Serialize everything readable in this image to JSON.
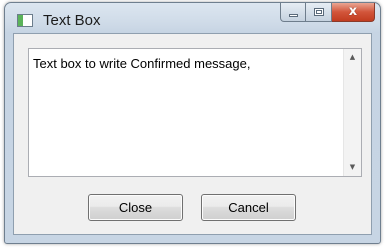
{
  "window": {
    "title": "Text Box",
    "close_glyph": "x"
  },
  "textbox": {
    "value": "Text box to write Confirmed message,",
    "scroll_up_glyph": "▲",
    "scroll_down_glyph": "▼"
  },
  "buttons": {
    "close_label": "Close",
    "cancel_label": "Cancel"
  },
  "icons": {
    "app": "textbox-app-icon",
    "minimize": "minimize-icon",
    "maximize": "maximize-icon",
    "close": "close-icon"
  },
  "colors": {
    "window_frame": "#c7d5e4",
    "close_button": "#c13c20",
    "client_background": "#f0f0f0"
  }
}
